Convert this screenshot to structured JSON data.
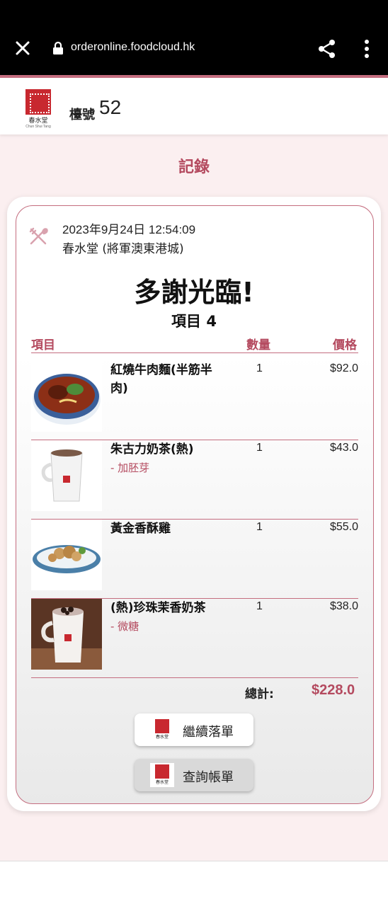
{
  "browser": {
    "url": "orderonline.foodcloud.hk"
  },
  "header": {
    "logo_cn": "春水堂",
    "logo_en": "Chun Shui Tang",
    "table_label": "檯號",
    "table_number": "52"
  },
  "page_title": "記錄",
  "receipt": {
    "datetime": "2023年9月24日 12:54:09",
    "store": "春水堂 (將軍澳東港城)",
    "thanks": "多謝光臨!",
    "item_count": "項目 4",
    "columns": {
      "item": "項目",
      "qty": "數量",
      "price": "價格"
    },
    "items": [
      {
        "name": "紅燒牛肉麵(半筋半肉)",
        "modifier": "",
        "qty": "1",
        "price": "$92.0",
        "image": "beef-noodle"
      },
      {
        "name": "朱古力奶茶(熱)",
        "modifier": "- 加胚芽",
        "qty": "1",
        "price": "$43.0",
        "image": "chocolate-milk-tea"
      },
      {
        "name": "黃金香酥雞",
        "modifier": "",
        "qty": "1",
        "price": "$55.0",
        "image": "fried-chicken"
      },
      {
        "name": "(熱)珍珠茉香奶茶",
        "modifier": "- 微糖",
        "qty": "1",
        "price": "$38.0",
        "image": "pearl-milk-tea"
      }
    ],
    "total_label": "總計:",
    "total_value": "$228.0"
  },
  "buttons": {
    "continue_label": "繼續落單",
    "bill_label": "查詢帳單"
  },
  "colors": {
    "accent": "#b44a5f",
    "border": "#c46d7f",
    "background": "#fbeff0"
  }
}
